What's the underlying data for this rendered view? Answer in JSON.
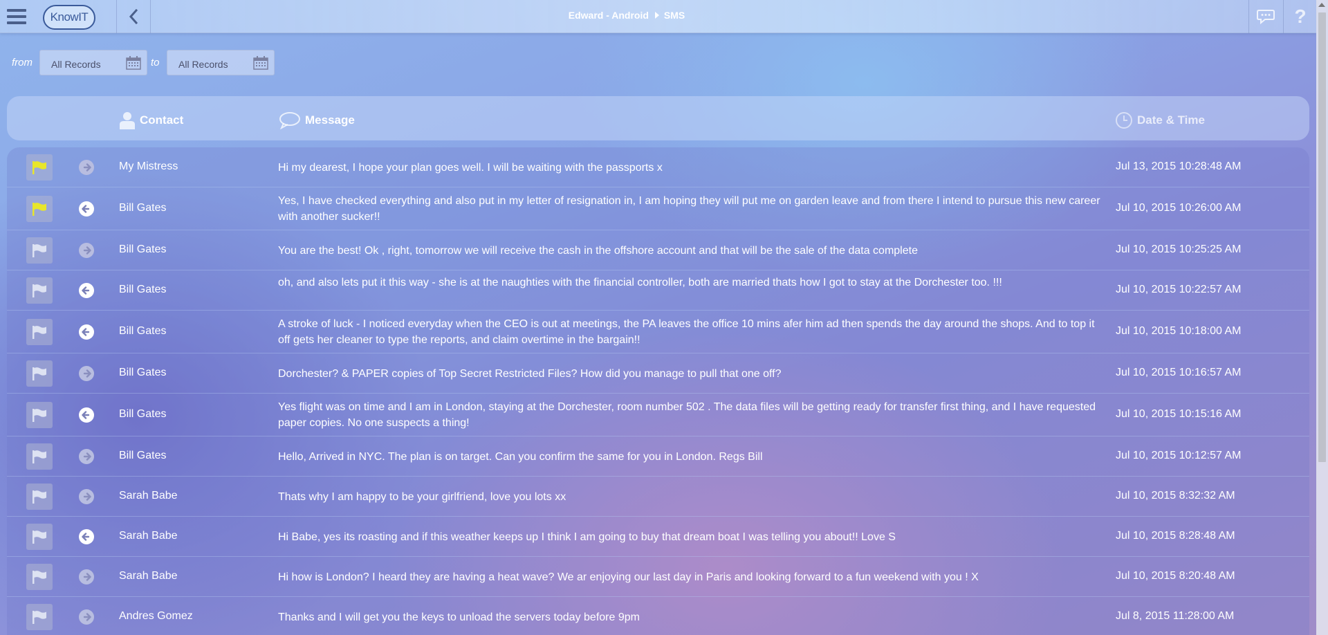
{
  "header": {
    "breadcrumb_device": "Edward - Android",
    "breadcrumb_section": "SMS",
    "logo_text": "KnowIT",
    "help_label": "?"
  },
  "filter": {
    "from_label": "from",
    "to_label": "to",
    "from_value": "All Records",
    "to_value": "All Records"
  },
  "table": {
    "columns": {
      "contact": "Contact",
      "message": "Message",
      "datetime": "Date & Time"
    },
    "rows": [
      {
        "flagged": true,
        "direction": "outgoing",
        "contact": "My Mistress",
        "message": "Hi my dearest, I hope your plan goes well. I will be waiting with the passports x",
        "datetime": "Jul 13, 2015 10:28:48 AM"
      },
      {
        "flagged": true,
        "direction": "incoming",
        "contact": "Bill Gates",
        "message": "Yes, I have checked everything and also put in my letter of resignation in, I am hoping they will put me on garden leave and from there I intend to pursue this new career with another sucker!!",
        "datetime": "Jul 10, 2015 10:26:00 AM"
      },
      {
        "flagged": false,
        "direction": "outgoing",
        "contact": "Bill Gates",
        "message": "You are the best! Ok , right, tomorrow we will receive the cash in the offshore account and that will be the sale of the data complete",
        "datetime": "Jul 10, 2015 10:25:25 AM"
      },
      {
        "flagged": false,
        "direction": "incoming",
        "contact": "Bill Gates",
        "message": "oh, and also lets put it this way - she is at the naughties with the financial controller, both are married thats how I got to stay at the Dorchester too. !!!",
        "datetime": "Jul 10, 2015 10:22:57 AM"
      },
      {
        "flagged": false,
        "direction": "incoming",
        "contact": "Bill Gates",
        "message": "A stroke of luck - I noticed everyday when the CEO is out at meetings, the PA leaves the office 10 mins afer him ad then spends the day around the shops. And to top it off gets her cleaner to type the reports, and claim overtime in the bargain!!",
        "datetime": "Jul 10, 2015 10:18:00 AM"
      },
      {
        "flagged": false,
        "direction": "outgoing",
        "contact": "Bill Gates",
        "message": "Dorchester? & PAPER copies of Top Secret Restricted Files? How did you manage to pull that one off?",
        "datetime": "Jul 10, 2015 10:16:57 AM"
      },
      {
        "flagged": false,
        "direction": "incoming",
        "contact": "Bill Gates",
        "message": "Yes flight was on time and I am in London, staying at the Dorchester, room number 502 . The data files will be getting ready for transfer first thing, and I have requested paper copies. No one suspects a thing!",
        "datetime": "Jul 10, 2015 10:15:16 AM"
      },
      {
        "flagged": false,
        "direction": "outgoing",
        "contact": "Bill Gates",
        "message": "Hello, Arrived in NYC. The plan is on target. Can you confirm the same for you in London. Regs Bill",
        "datetime": "Jul 10, 2015 10:12:57 AM"
      },
      {
        "flagged": false,
        "direction": "outgoing",
        "contact": "Sarah Babe",
        "message": "Thats why I am happy to be your girlfriend, love you lots xx",
        "datetime": "Jul 10, 2015 8:32:32 AM"
      },
      {
        "flagged": false,
        "direction": "incoming",
        "contact": "Sarah Babe",
        "message": "Hi Babe, yes its roasting and if this weather keeps up I think I am going to buy that dream boat I was telling you about!! Love S",
        "datetime": "Jul 10, 2015 8:28:48 AM"
      },
      {
        "flagged": false,
        "direction": "outgoing",
        "contact": "Sarah Babe",
        "message": "Hi how is London? I heard they are having a heat wave? We ar enjoying our last day in Paris and looking forward to a fun weekend with you ! X",
        "datetime": "Jul 10, 2015 8:20:48 AM"
      },
      {
        "flagged": false,
        "direction": "outgoing",
        "contact": "Andres Gomez",
        "message": "Thanks and I will get you the keys to unload the servers today before 9pm",
        "datetime": "Jul 8, 2015 11:28:00 AM"
      }
    ]
  },
  "colors": {
    "flag_active": "#e8e62a",
    "flag_inactive": "#dde2f2",
    "incoming_circle": "#ffffff",
    "outgoing_circle": "#b8bde0"
  },
  "icons": {
    "menu": "hamburger-icon",
    "back": "chevron-left-icon",
    "chat": "chat-bubble-icon",
    "help": "question-mark-icon",
    "calendar": "calendar-icon",
    "contact": "person-icon",
    "message": "speech-bubble-icon",
    "datetime": "clock-icon",
    "flag": "flag-icon",
    "incoming": "arrow-left-circle-icon",
    "outgoing": "arrow-right-circle-icon"
  }
}
